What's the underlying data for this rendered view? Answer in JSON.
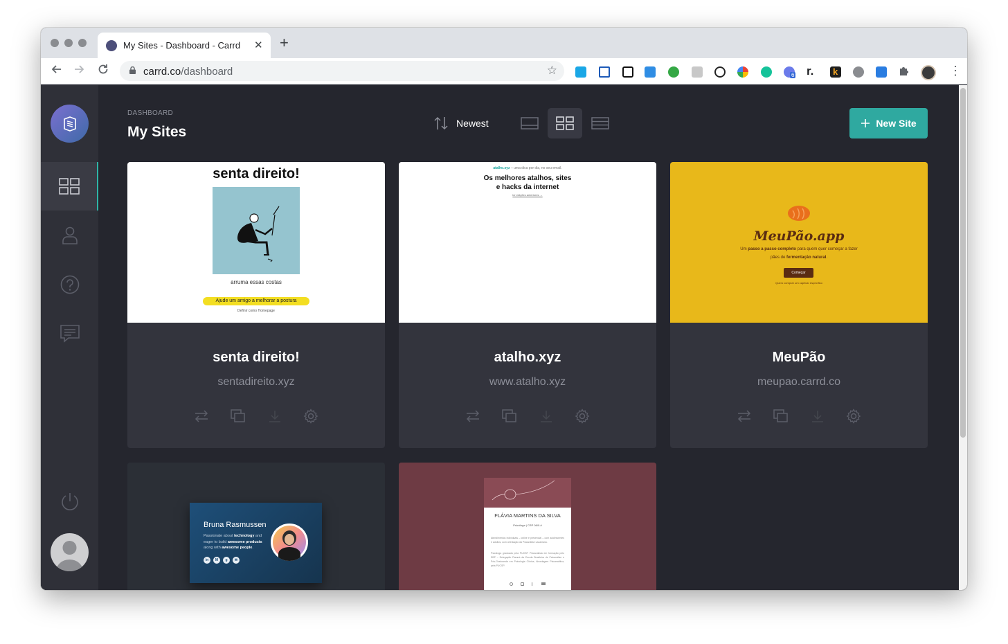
{
  "browser": {
    "tab_title": "My Sites - Dashboard - Carrd",
    "tab_close": "✕",
    "new_tab": "+",
    "url_host": "carrd.co",
    "url_path": "/dashboard",
    "extension_badge": "6",
    "ext_r": "r.",
    "ext_k": "k"
  },
  "header": {
    "breadcrumb": "DASHBOARD",
    "title": "My Sites",
    "sort_label": "Newest",
    "new_site_label": "New Site"
  },
  "sidebar": {
    "items": [
      {
        "icon": "dashboard-grid-icon",
        "active": true
      },
      {
        "icon": "user-icon",
        "active": false
      },
      {
        "icon": "help-icon",
        "active": false
      },
      {
        "icon": "message-icon",
        "active": false
      }
    ],
    "power_icon": "power-icon"
  },
  "sites": [
    {
      "name": "senta direito!",
      "url": "sentadireito.xyz",
      "preview": {
        "heading": "senta direito!",
        "caption": "arruma essas costas",
        "button": "Ajude um amigo a melhorar a postura",
        "footer": "Definir como Homepage"
      }
    },
    {
      "name": "atalho.xyz",
      "url": "www.atalho.xyz",
      "preview": {
        "tagline_brand": "atalho.xyz",
        "tagline_rest": " – uma dica por dia, no seu email.",
        "heading_line1": "Os melhores atalhos, sites",
        "heading_line2": "e hacks da internet",
        "link": "ler edições anteriores →"
      }
    },
    {
      "name": "MeuPão",
      "url": "meupao.carrd.co",
      "preview": {
        "brand": "MeuPão.app",
        "line1_a": "Um ",
        "line1_b": "passo a passo completo",
        "line1_c": " para quem quer começar a fazer",
        "line2_a": "pães de ",
        "line2_b": "fermentação natural",
        "line2_c": ".",
        "button": "Começar",
        "link": "Quero comprar um capítulo específico"
      }
    },
    {
      "preview": {
        "name": "Bruna Rasmussen",
        "bio_1": "Passionate about ",
        "bio_2": "technology",
        "bio_3": " and",
        "bio_4": "eager to build ",
        "bio_5": "awesome products",
        "bio_6": "along with ",
        "bio_7": "awesome people",
        "bio_8": ".",
        "socials": [
          "in",
          "M",
          "g",
          "✉"
        ]
      }
    },
    {
      "preview": {
        "name": "FLÁVIA MARTINS DA SILVA",
        "subtitle": "Psicóloga | CRP 06/0-#",
        "para1": "Atendimentos individuais – online e presencial – com adolescentes e adultos, com orientação da Psicanálise Lacaniana.",
        "para2": "Psicóloga graduada pela PUCSP. Psicanalista em formação pelo EBP – Delegação Paraná da Escola Brasileira de Psicanálise e Pós-Graduanda em Psicologia Clínica, Abordagem Psicanalítica, pela PUCSP."
      }
    }
  ],
  "colors": {
    "accent": "#2fa9a0",
    "background": "#25262e",
    "card": "#33343d",
    "meupao_bg": "#e8b81a",
    "flavia_bg": "#6e3b44",
    "bruna_outer_bg": "#2b2f36"
  }
}
